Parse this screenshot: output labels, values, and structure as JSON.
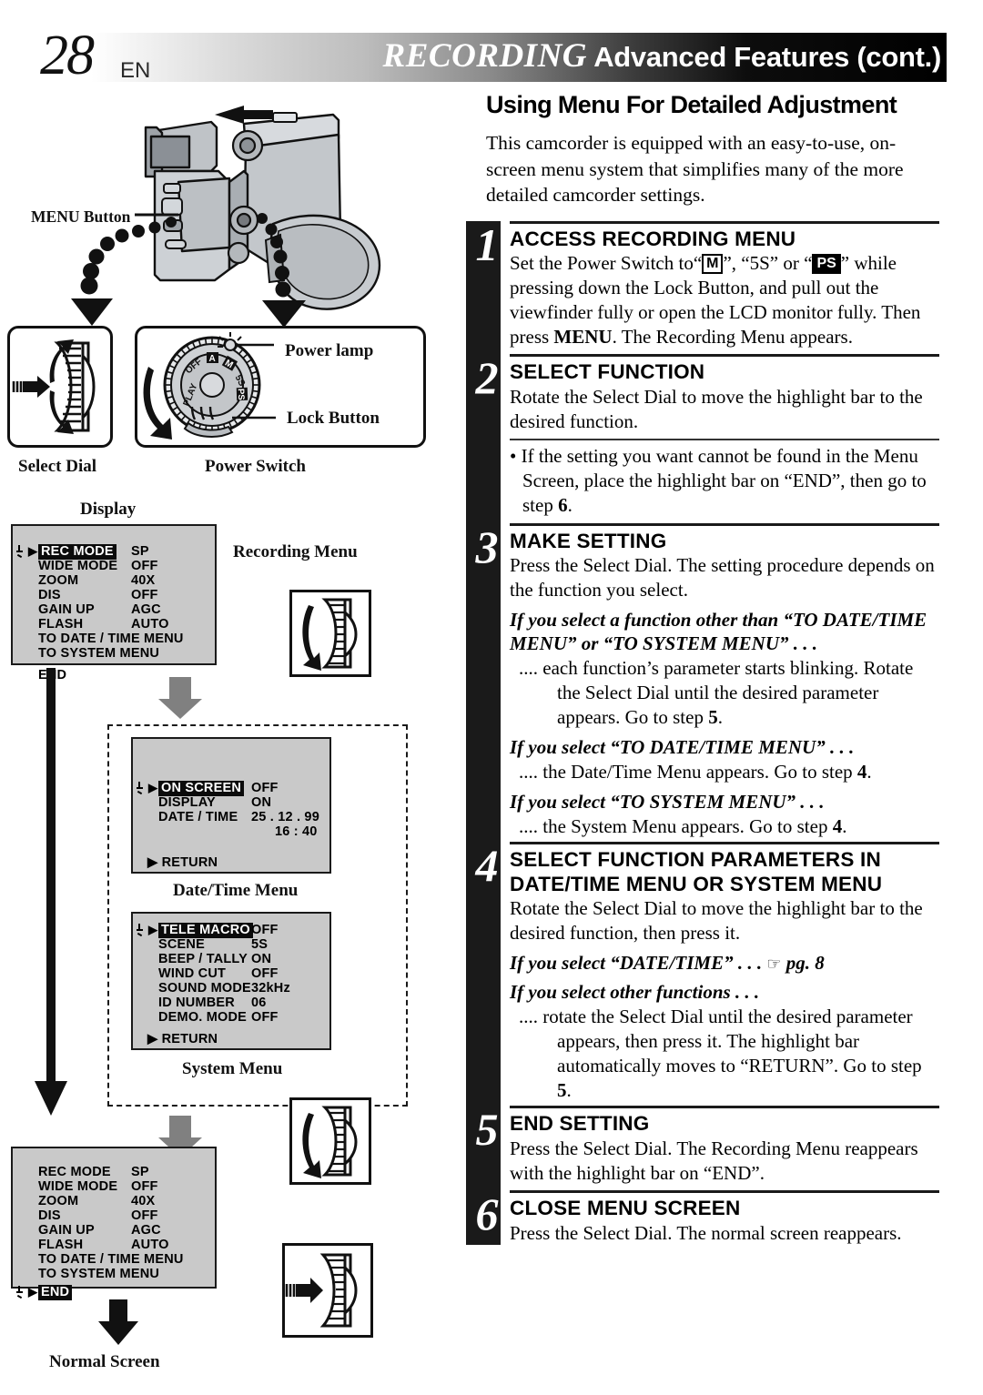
{
  "header": {
    "page_number": "28",
    "language": "EN",
    "title_emphasis": "RECORDING",
    "title_rest": " Advanced Features (cont.)"
  },
  "main": {
    "subtitle": "Using Menu For Detailed Adjustment",
    "intro": "This camcorder is equipped with an easy-to-use, on-screen menu system that simplifies many of the more detailed camcorder settings."
  },
  "steps": [
    {
      "number": "1",
      "title": "ACCESS RECORDING MENU",
      "body_pre": "Set the Power Switch to“",
      "icon_m": "M",
      "body_mid": "”, “5S” or “",
      "icon_ps": "PS",
      "body_post": "” while pressing down the Lock Button, and pull out the viewfinder fully or open the LCD monitor fully. Then press ",
      "body_bold": "MENU",
      "body_end": ". The Recording Menu appears."
    },
    {
      "number": "2",
      "title": "SELECT FUNCTION",
      "body": "Rotate the Select Dial to move the highlight bar to the desired function.",
      "bullet": "• If the setting you want cannot be found in the Menu Screen, place the highlight bar on “END”, then go to step ",
      "bullet_bold": "6",
      "bullet_end": "."
    },
    {
      "number": "3",
      "title": "MAKE SETTING",
      "body": "Press the Select Dial. The setting procedure depends on the function you select.",
      "conditions": [
        {
          "heading": "If you select a function other than “TO DATE/TIME MENU” or “TO SYSTEM MENU” . . .",
          "text": ".... each function’s parameter starts blinking. Rotate the Select Dial until the desired parameter appears. Go to step ",
          "bold": "5",
          "end": "."
        },
        {
          "heading": "If you select “TO DATE/TIME MENU” . . .",
          "text": ".... the Date/Time Menu appears. Go to step ",
          "bold": "4",
          "end": "."
        },
        {
          "heading": "If you select “TO SYSTEM MENU” . . .",
          "text": ".... the System Menu appears. Go to step ",
          "bold": "4",
          "end": "."
        }
      ]
    },
    {
      "number": "4",
      "title_line1": "SELECT FUNCTION PARAMETERS IN",
      "title_line2": "DATE/TIME MENU OR SYSTEM MENU",
      "body": "Rotate the Select Dial to move the highlight bar to the desired function, then press it.",
      "cond1": "If you select “DATE/TIME” . . .",
      "cond1_ref": "pg. 8",
      "cond2": "If you select other functions . . .",
      "cond2_text": ".... rotate the Select Dial until the desired parameter appears, then press it. The highlight bar automatically moves to “RETURN”. Go to step ",
      "cond2_bold": "5",
      "cond2_end": "."
    },
    {
      "number": "5",
      "title": "END SETTING",
      "body": "Press the Select Dial. The Recording Menu reappears with the highlight bar on “END”."
    },
    {
      "number": "6",
      "title": "CLOSE MENU SCREEN",
      "body": "Press the Select Dial. The normal screen reappears."
    }
  ],
  "diagram": {
    "labels": {
      "menu_button": "MENU Button",
      "power_lamp": "Power lamp",
      "lock_button": "Lock Button",
      "select_dial": "Select Dial",
      "power_switch": "Power Switch",
      "display": "Display",
      "recording_menu": "Recording Menu",
      "date_time_menu": "Date/Time Menu",
      "system_menu": "System Menu",
      "normal_screen": "Normal Screen"
    },
    "power_switch_positions": [
      "PLAY",
      "OFF",
      "A",
      "M",
      "5S",
      "PS"
    ],
    "recording_menu": {
      "highlight_index": 0,
      "rows": [
        {
          "name": "REC MODE",
          "value": "SP"
        },
        {
          "name": "WIDE MODE",
          "value": "OFF"
        },
        {
          "name": "ZOOM",
          "value": "40X"
        },
        {
          "name": "DIS",
          "value": "OFF"
        },
        {
          "name": "GAIN UP",
          "value": "AGC"
        },
        {
          "name": "FLASH",
          "value": "AUTO"
        }
      ],
      "wide_rows": [
        "TO DATE / TIME MENU",
        "TO SYSTEM MENU"
      ],
      "end_label": "END"
    },
    "date_time_menu": {
      "highlight_index": 0,
      "rows": [
        {
          "name": "ON SCREEN",
          "value": "OFF"
        },
        {
          "name": "DISPLAY",
          "value": "ON"
        },
        {
          "name": "DATE / TIME",
          "value": "25 . 12 . 99"
        }
      ],
      "time_value": "16 : 40",
      "return_label": "▶ RETURN"
    },
    "system_menu": {
      "highlight_index": 0,
      "rows": [
        {
          "name": "TELE MACRO",
          "value": "OFF"
        },
        {
          "name": "SCENE",
          "value": "5S"
        },
        {
          "name": "BEEP / TALLY",
          "value": "ON"
        },
        {
          "name": "WIND CUT",
          "value": "OFF"
        },
        {
          "name": "SOUND MODE",
          "value": "32kHz"
        },
        {
          "name": "ID NUMBER",
          "value": "06"
        },
        {
          "name": "DEMO. MODE",
          "value": "OFF"
        }
      ],
      "return_label": "▶ RETURN"
    },
    "final_menu": {
      "highlight_index": 8,
      "rows": [
        {
          "name": "REC MODE",
          "value": "SP"
        },
        {
          "name": "WIDE MODE",
          "value": "OFF"
        },
        {
          "name": "ZOOM",
          "value": "40X"
        },
        {
          "name": "DIS",
          "value": "OFF"
        },
        {
          "name": "GAIN UP",
          "value": "AGC"
        },
        {
          "name": "FLASH",
          "value": "AUTO"
        }
      ],
      "wide_rows": [
        "TO DATE / TIME MENU",
        "TO SYSTEM MENU"
      ],
      "end_label": "END"
    }
  },
  "colors": {
    "osd_bg": "#c9c9c9",
    "ink": "#1a1a1a",
    "gray_arrow": "#808080"
  }
}
